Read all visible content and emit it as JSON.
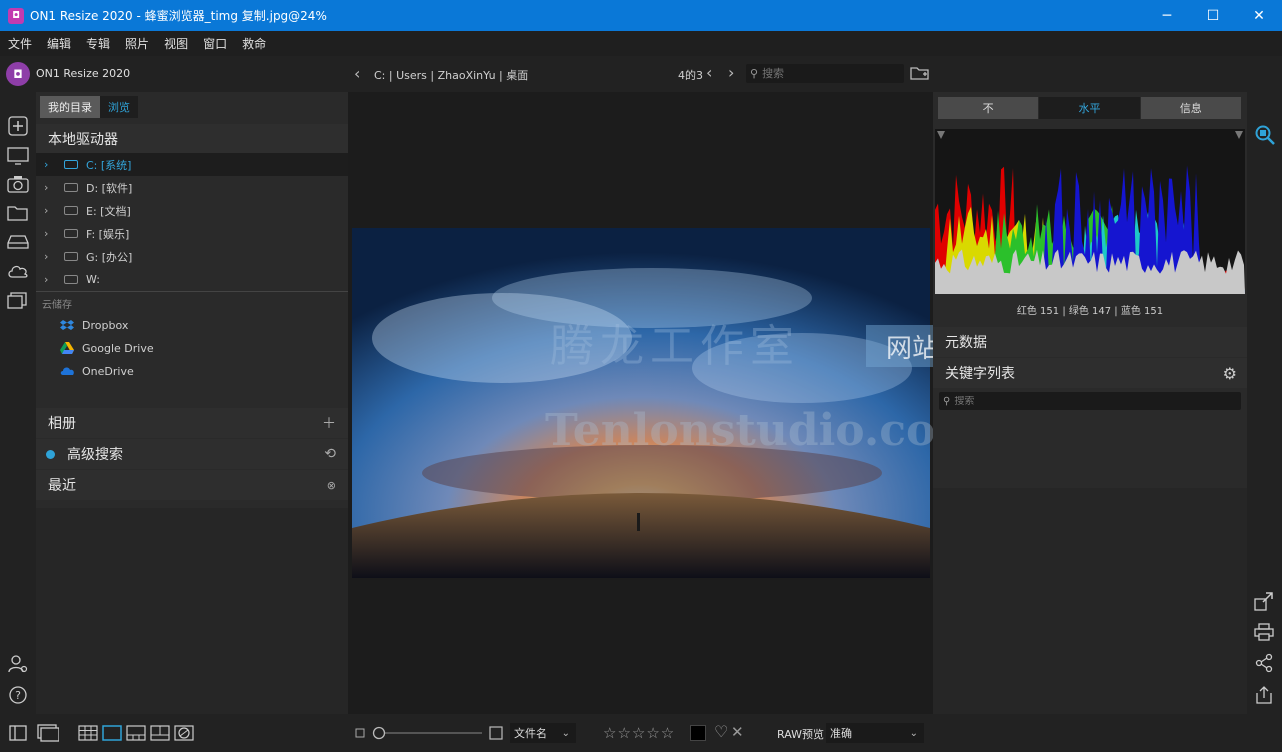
{
  "window": {
    "app_icon": "on1-icon",
    "title": "ON1 Resize 2020 - 蜂蜜浏览器_timg 复制.jpg@24%",
    "minimize": "─",
    "maximize": "☐",
    "close": "✕"
  },
  "menu": [
    "文件",
    "编辑",
    "专辑",
    "照片",
    "视图",
    "窗口",
    "救命"
  ],
  "app": {
    "name": "ON1 Resize 2020",
    "logo": "on1-logo"
  },
  "path": {
    "text": "C: | Users | ZhaoXinYu | 桌面",
    "page_count": "4的3",
    "search_placeholder": "搜索"
  },
  "left_panel": {
    "tabs": [
      "我的目录",
      "浏览"
    ],
    "local_header": "本地驱动器",
    "drives": [
      {
        "label": "C: [系统]",
        "selected": true
      },
      {
        "label": "D: [软件]",
        "selected": false
      },
      {
        "label": "E: [文档]",
        "selected": false
      },
      {
        "label": "F: [娱乐]",
        "selected": false
      },
      {
        "label": "G: [办公]",
        "selected": false
      },
      {
        "label": "W:",
        "selected": false
      }
    ],
    "cloud_header": "云储存",
    "cloud": [
      "Dropbox",
      "Google Drive",
      "OneDrive"
    ],
    "albums": "相册",
    "advanced_search": "高级搜索",
    "recent": "最近"
  },
  "right_panel": {
    "segments": [
      "不",
      "水平",
      "信息"
    ],
    "active_segment": 1,
    "rgb_readout": "红色 151 | 绿色 147 | 蓝色 151",
    "metadata": "元数据",
    "keywords": "关键字列表",
    "search_placeholder": "搜索"
  },
  "watermark": {
    "line1": "腾龙工作室",
    "box": "网站",
    "line2": "Tenlonstudio.com"
  },
  "bottom": {
    "sort_label": "文件名",
    "raw_label": "RAW预览",
    "raw_value": "准确",
    "stars": "☆☆☆☆☆"
  },
  "colors": {
    "titlebar": "#0a78d7",
    "accent": "#2fa3d8",
    "panel": "#2a2a2a"
  }
}
